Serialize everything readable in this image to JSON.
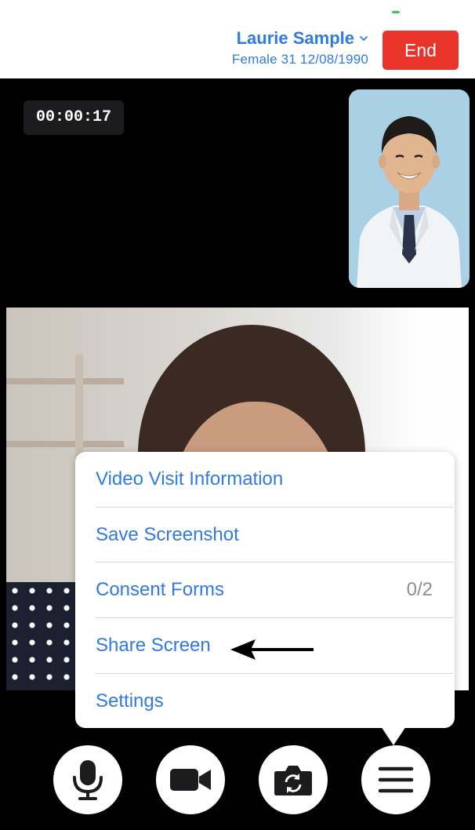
{
  "header": {
    "patient_name": "Laurie Sample",
    "patient_meta": "Female 31 12/08/1990",
    "end_label": "End"
  },
  "video": {
    "timer": "00:00:17"
  },
  "menu": {
    "items": [
      {
        "label": "Video Visit Information"
      },
      {
        "label": "Save Screenshot"
      },
      {
        "label": "Consent Forms",
        "count": "0/2"
      },
      {
        "label": "Share Screen"
      },
      {
        "label": "Settings"
      }
    ]
  },
  "controls": {
    "icons": [
      "microphone-icon",
      "video-camera-icon",
      "switch-camera-icon",
      "menu-icon"
    ]
  },
  "colors": {
    "accent": "#2f7ae5",
    "end_button": "#e8342b",
    "video_background": "#000000",
    "muted_text": "#8e8e93"
  }
}
